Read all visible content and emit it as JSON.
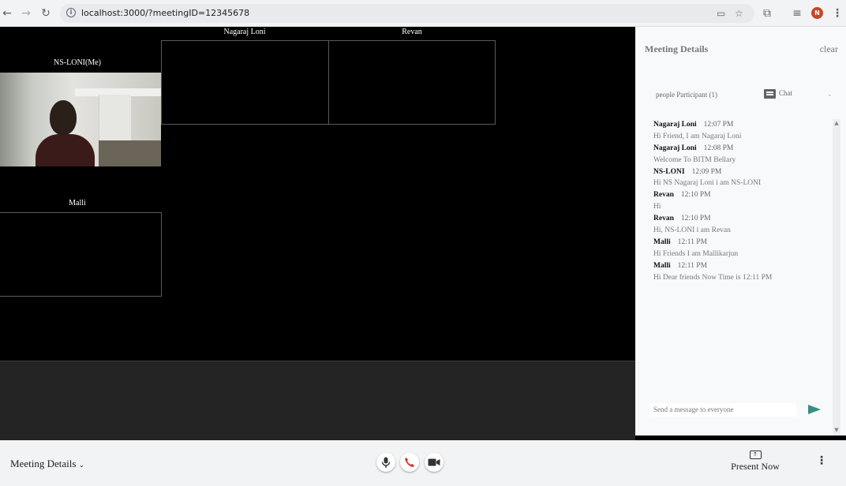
{
  "browser": {
    "url": "localhost:3000/?meetingID=12345678",
    "profile_initial": "N"
  },
  "tiles": {
    "me_label": "NS-LONI(Me)",
    "nagaraj_label": "Nagaraj Loni",
    "revan_label": "Revan",
    "malli_label": "Malli"
  },
  "panel": {
    "title": "Meeting Details",
    "clear": "clear",
    "participants_tab": "people Participant (1)",
    "chat_tab": "Chat",
    "compose_placeholder": "Send a message to everyone",
    "messages": [
      {
        "sender": "Nagaraj Loni",
        "time": "12:07 PM",
        "text": "Hi Friend, I am Nagaraj Loni"
      },
      {
        "sender": "Nagaraj Loni",
        "time": "12:08 PM",
        "text": "Welcome To BITM Bellary"
      },
      {
        "sender": "NS-LONI",
        "time": "12:09 PM",
        "text": "Hi NS Nagaraj Loni i am NS-LONI"
      },
      {
        "sender": "Revan",
        "time": "12:10 PM",
        "text": "Hi"
      },
      {
        "sender": "Revan",
        "time": "12:10 PM",
        "text": "Hi, NS-LONI i am Revan"
      },
      {
        "sender": "Malli",
        "time": "12:11 PM",
        "text": "Hi Friends I am Mallikarjun"
      },
      {
        "sender": "Malli",
        "time": "12:11 PM",
        "text": "Hi Dear friends Now Time is 12:11 PM"
      }
    ]
  },
  "toolbar": {
    "meeting_details": "Meeting Details",
    "present_now": "Present Now"
  },
  "colors": {
    "send": "#3d8c84",
    "end_call": "#d93025"
  }
}
